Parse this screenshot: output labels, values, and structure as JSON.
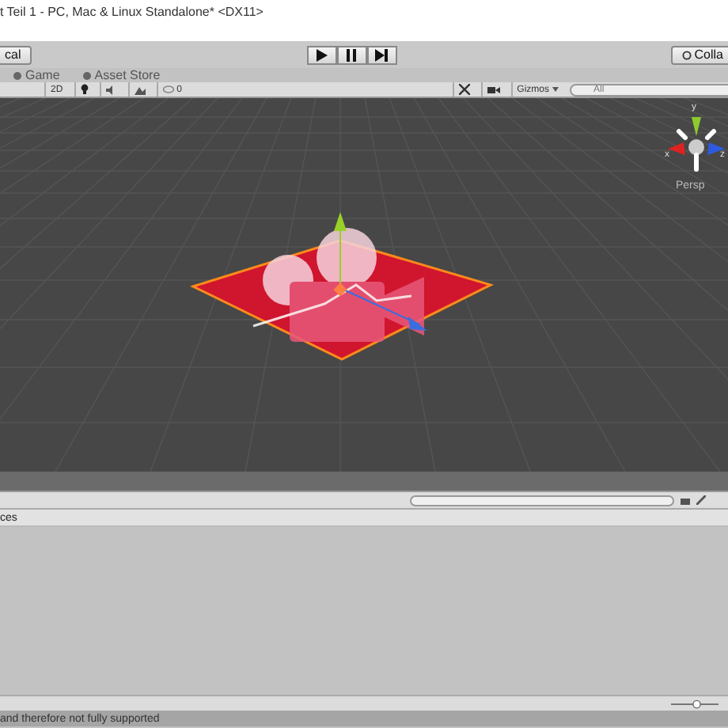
{
  "window": {
    "title": "t Teil 1 - PC, Mac & Linux Standalone* <DX11>"
  },
  "toolbar": {
    "left_button": "cal",
    "right_button": "Colla"
  },
  "tabs": [
    {
      "label": "Game",
      "selected": false
    },
    {
      "label": "Asset Store",
      "selected": false
    }
  ],
  "scene_toolbar": {
    "mode_button": "2D",
    "effects_count": "0",
    "gizmos": "Gizmos",
    "search_placeholder": "All"
  },
  "scene": {
    "view_label": "Persp",
    "axes": [
      "y",
      "x",
      "z"
    ]
  },
  "panel": {
    "label": "ces"
  },
  "zoom_slider": {
    "level": 0.55
  },
  "status_bar": {
    "message": "and therefore not fully supported"
  }
}
